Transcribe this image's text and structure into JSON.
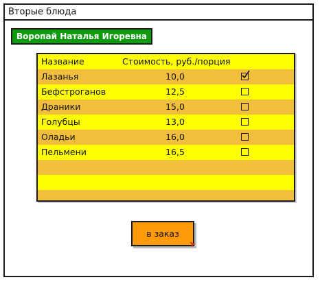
{
  "window": {
    "title": "Вторые блюда"
  },
  "user": {
    "name": "Воропай Наталья Игоревна"
  },
  "table": {
    "headers": {
      "name": "Название",
      "price": "Стоимость, руб./порция"
    },
    "rows": [
      {
        "name": "Лазанья",
        "price": "10,0",
        "checked": true
      },
      {
        "name": "Бефстроганов",
        "price": "12,5",
        "checked": false
      },
      {
        "name": "Драники",
        "price": "15,0",
        "checked": false
      },
      {
        "name": "Голубцы",
        "price": "13,0",
        "checked": false
      },
      {
        "name": "Оладьи",
        "price": "16,0",
        "checked": false
      },
      {
        "name": "Пельмени",
        "price": "16,5",
        "checked": false
      }
    ]
  },
  "order_button": {
    "label": "в заказ"
  },
  "colors": {
    "user_badge": "#0f9b0f",
    "row_yellow": "#ffff00",
    "row_orange": "#f1bf3c",
    "button": "#ff9a0a"
  }
}
